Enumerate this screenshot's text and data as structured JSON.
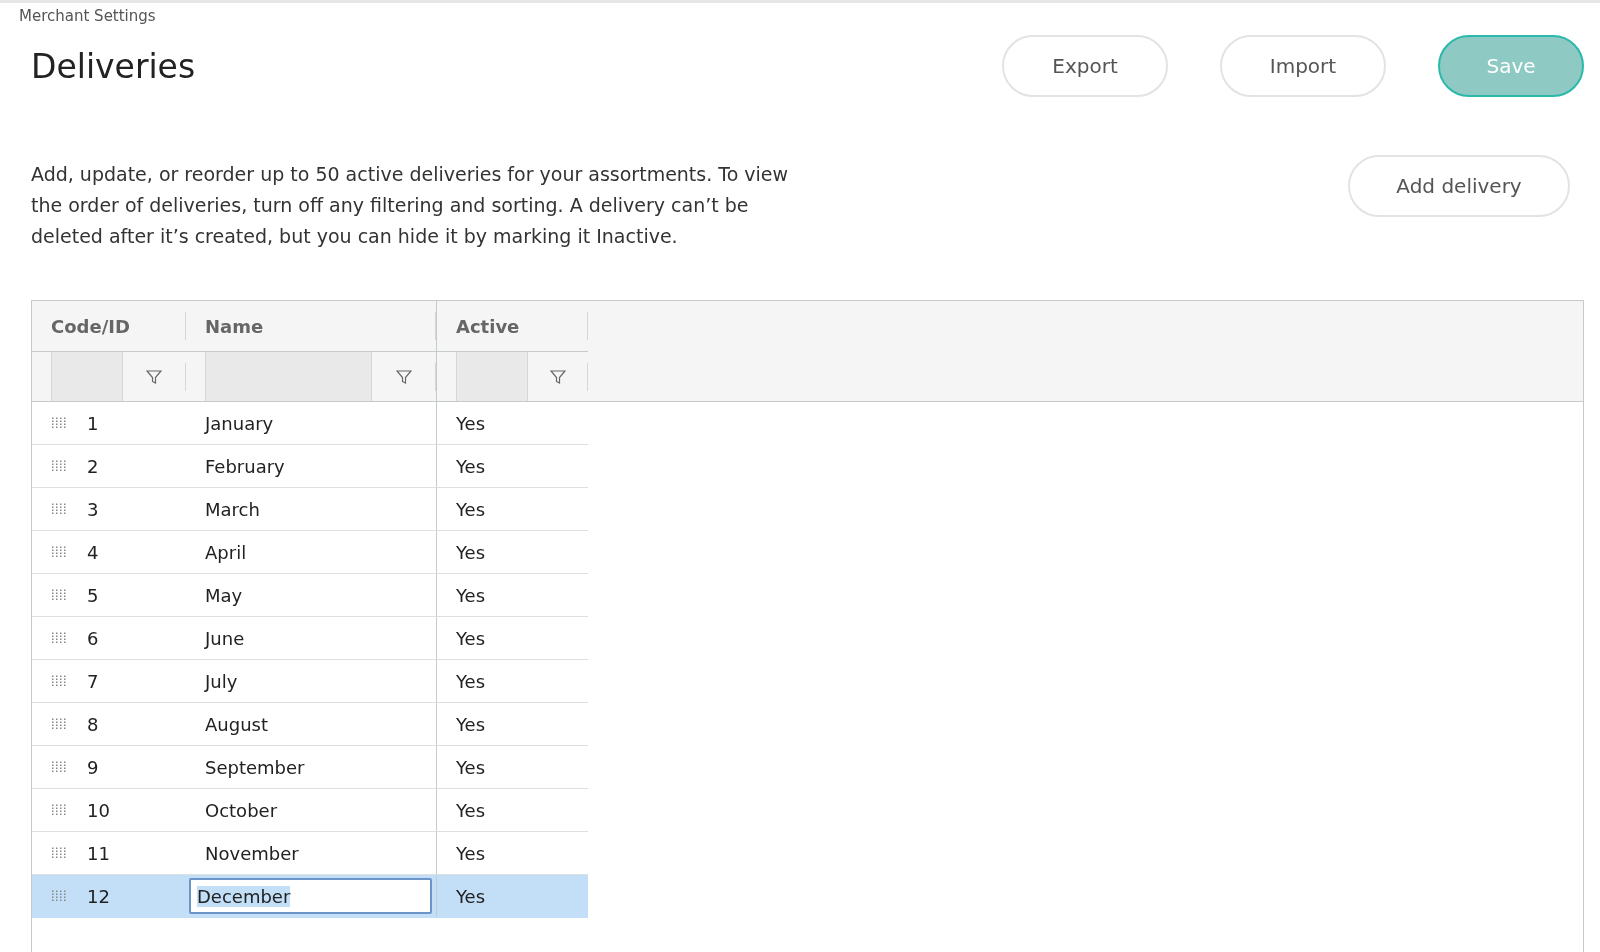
{
  "breadcrumb": "Merchant Settings",
  "title": "Deliveries",
  "header_buttons": [
    {
      "label": "Export",
      "kind": "secondary"
    },
    {
      "label": "Import",
      "kind": "secondary"
    },
    {
      "label": "Save",
      "kind": "primary"
    }
  ],
  "description": "Add, update, or reorder up to 50 active deliveries for your assortments. To view the order of deliveries, turn off any filtering and sorting. A delivery can’t be deleted after it’s created, but you can hide it by marking it Inactive.",
  "add_button": {
    "label": "Add delivery"
  },
  "table": {
    "columns": [
      "Code/ID",
      "Name",
      "Active"
    ],
    "rows": [
      {
        "code": "1",
        "name": "January",
        "active": "Yes",
        "selected": false,
        "editing": false
      },
      {
        "code": "2",
        "name": "February",
        "active": "Yes",
        "selected": false,
        "editing": false
      },
      {
        "code": "3",
        "name": "March",
        "active": "Yes",
        "selected": false,
        "editing": false
      },
      {
        "code": "4",
        "name": "April",
        "active": "Yes",
        "selected": false,
        "editing": false
      },
      {
        "code": "5",
        "name": "May",
        "active": "Yes",
        "selected": false,
        "editing": false
      },
      {
        "code": "6",
        "name": "June",
        "active": "Yes",
        "selected": false,
        "editing": false
      },
      {
        "code": "7",
        "name": "July",
        "active": "Yes",
        "selected": false,
        "editing": false
      },
      {
        "code": "8",
        "name": "August",
        "active": "Yes",
        "selected": false,
        "editing": false
      },
      {
        "code": "9",
        "name": "September",
        "active": "Yes",
        "selected": false,
        "editing": false
      },
      {
        "code": "10",
        "name": "October",
        "active": "Yes",
        "selected": false,
        "editing": false
      },
      {
        "code": "11",
        "name": "November",
        "active": "Yes",
        "selected": false,
        "editing": false
      },
      {
        "code": "12",
        "name": "December",
        "active": "Yes",
        "selected": true,
        "editing": true
      }
    ]
  }
}
